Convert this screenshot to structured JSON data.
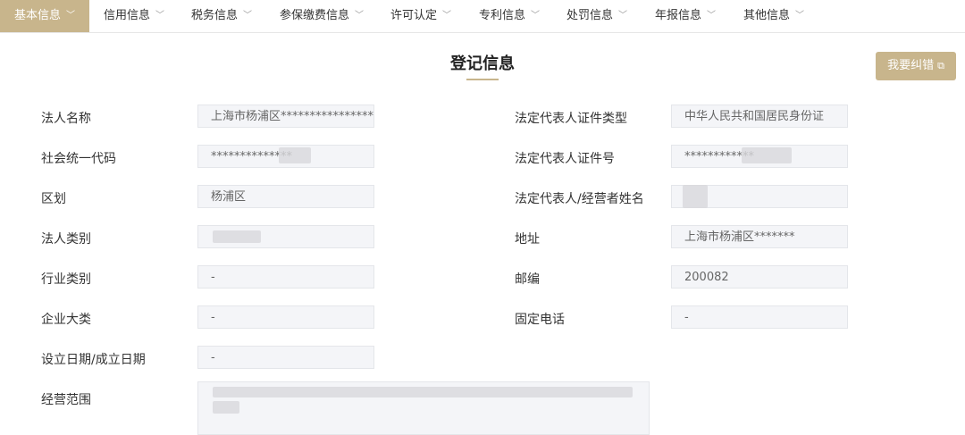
{
  "tabs": [
    {
      "label": "基本信息"
    },
    {
      "label": "信用信息"
    },
    {
      "label": "税务信息"
    },
    {
      "label": "参保缴费信息"
    },
    {
      "label": "许可认定"
    },
    {
      "label": "专利信息"
    },
    {
      "label": "处罚信息"
    },
    {
      "label": "年报信息"
    },
    {
      "label": "其他信息"
    }
  ],
  "page": {
    "title": "登记信息",
    "correct_button": "我要纠错"
  },
  "fields": {
    "legal_name": {
      "label": "法人名称",
      "value": "上海市杨浦区*****************"
    },
    "rep_cert_type": {
      "label": "法定代表人证件类型",
      "value": "中华人民共和国居民身份证"
    },
    "credit_code": {
      "label": "社会统一代码",
      "value": "**************"
    },
    "rep_cert_no": {
      "label": "法定代表人证件号",
      "value": "************"
    },
    "district": {
      "label": "区划",
      "value": "杨浦区"
    },
    "rep_name": {
      "label": "法定代表人/经营者姓名",
      "value": ""
    },
    "legal_type": {
      "label": "法人类别",
      "value": ""
    },
    "address": {
      "label": "地址",
      "value": "上海市杨浦区*******"
    },
    "industry": {
      "label": "行业类别",
      "value": "-"
    },
    "postcode": {
      "label": "邮编",
      "value": "200082"
    },
    "enterprise_class": {
      "label": "企业大类",
      "value": "-"
    },
    "phone": {
      "label": "固定电话",
      "value": "-"
    },
    "established": {
      "label": "设立日期/成立日期",
      "value": "-"
    },
    "scope": {
      "label": "经营范围",
      "value": ""
    }
  }
}
